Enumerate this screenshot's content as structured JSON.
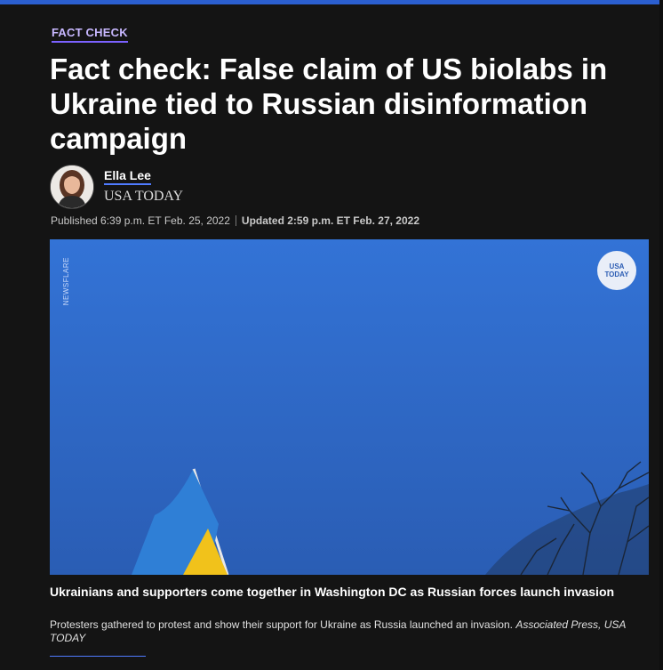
{
  "section_label": "FACT CHECK",
  "headline": "Fact check: False claim of US biolabs in Ukraine tied to Russian disinformation campaign",
  "author": {
    "name": "Ella Lee",
    "org": "USA TODAY"
  },
  "dates": {
    "published": "Published 6:39 p.m. ET Feb. 25, 2022",
    "updated": "Updated 2:59 p.m. ET Feb. 27, 2022"
  },
  "media": {
    "watermark": "NEWSFLARE",
    "logo_line1": "USA",
    "logo_line2": "TODAY"
  },
  "caption": {
    "title": "Ukrainians and supporters come together in Washington DC as Russian forces launch invasion",
    "desc": "Protesters gathered to protest and show their support for Ukraine as Russia launched an invasion.",
    "credit": "Associated Press, USA TODAY"
  },
  "colors": {
    "accent": "#4f7bff",
    "label": "#c8b8ff",
    "background": "#141414"
  }
}
